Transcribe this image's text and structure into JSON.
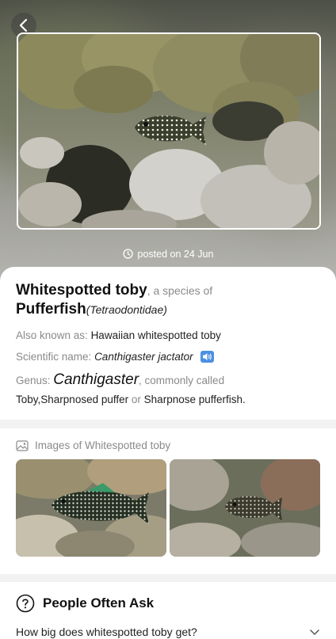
{
  "hero": {
    "posted_label": "posted on 24 Jun"
  },
  "species": {
    "common_name": "Whitespotted toby",
    "species_of_label": ", a species of",
    "family_common": "Pufferfish",
    "family_scientific": "(Tetraodontidae)",
    "aka_label": "Also known as:",
    "aka_value": "Hawaiian whitespotted toby",
    "scientific_label": "Scientific name:",
    "scientific_value": "Canthigaster jactator",
    "genus_label": "Genus:",
    "genus_value": "Canthigaster",
    "commonly_called": ", commonly called",
    "common_names": [
      "Toby",
      "Sharpnosed puffer",
      "Sharpnose pufferfish"
    ],
    "separator_comma": ",",
    "or_label": "or",
    "period": "."
  },
  "images": {
    "title": "Images of Whitespotted toby"
  },
  "ask": {
    "title": "People Often Ask",
    "questions": [
      "How big does whitespotted toby get?"
    ]
  },
  "colors": {
    "accent_blue": "#4a90e2",
    "card_bg": "#ffffff",
    "page_bg": "#f2f2f2"
  }
}
